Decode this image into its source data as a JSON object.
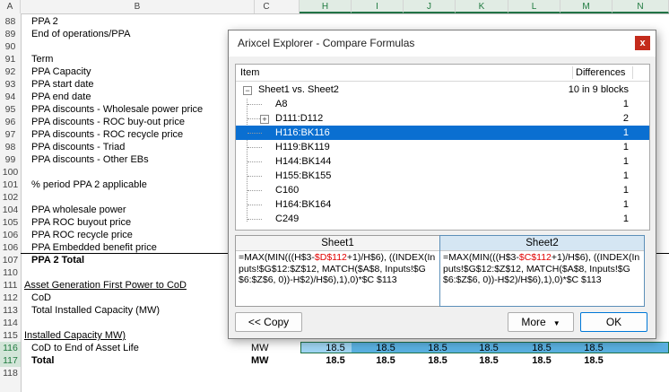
{
  "spreadsheet": {
    "columns": [
      "A",
      "B",
      "C",
      "H",
      "I",
      "J",
      "K",
      "L",
      "M",
      "N"
    ],
    "rows": [
      {
        "n": "88",
        "label": "PPA 2"
      },
      {
        "n": "89",
        "label": "End of operations/PPA"
      },
      {
        "n": "90",
        "label": ""
      },
      {
        "n": "91",
        "label": "Term"
      },
      {
        "n": "92",
        "label": "PPA Capacity"
      },
      {
        "n": "93",
        "label": "PPA start date"
      },
      {
        "n": "94",
        "label": "PPA end date"
      },
      {
        "n": "95",
        "label": "PPA discounts - Wholesale power price"
      },
      {
        "n": "96",
        "label": "PPA discounts - ROC buy-out price"
      },
      {
        "n": "97",
        "label": "PPA discounts - ROC recycle price"
      },
      {
        "n": "98",
        "label": "PPA discounts - Triad"
      },
      {
        "n": "99",
        "label": "PPA discounts - Other EBs"
      },
      {
        "n": "100",
        "label": ""
      },
      {
        "n": "101",
        "label": "% period PPA 2 applicable"
      },
      {
        "n": "102",
        "label": ""
      },
      {
        "n": "104",
        "label": "PPA wholesale power"
      },
      {
        "n": "105",
        "label": "PPA ROC buyout price"
      },
      {
        "n": "106",
        "label": "PPA ROC recycle price"
      },
      {
        "n": "106",
        "label": "PPA Embedded benefit price"
      },
      {
        "n": "107",
        "label": "PPA 2 Total"
      },
      {
        "n": "110",
        "label": ""
      },
      {
        "n": "111",
        "label": "Asset Generation First Power to CoD"
      },
      {
        "n": "112",
        "label": "CoD"
      },
      {
        "n": "113",
        "label": "Total Installed Capacity (MW)"
      },
      {
        "n": "114",
        "label": ""
      },
      {
        "n": "115",
        "label": "Installed Capacity MW)"
      },
      {
        "n": "116",
        "label": "CoD to End of Asset Life"
      },
      {
        "n": "117",
        "label": "Total"
      },
      {
        "n": "118",
        "label": ""
      }
    ],
    "unit_116": "MW",
    "unit_117": "MW",
    "values_116": [
      "18.5",
      "18.5",
      "18.5",
      "18.5",
      "18.5",
      "18.5"
    ],
    "values_117": [
      "18.5",
      "18.5",
      "18.5",
      "18.5",
      "18.5",
      "18.5"
    ]
  },
  "dialog": {
    "title": "Arixcel Explorer - Compare Formulas",
    "close": "x",
    "header_item": "Item",
    "header_diff": "Differences",
    "tree": [
      {
        "label": "Sheet1 vs. Sheet2",
        "diff": "10 in 9 blocks",
        "level": 0,
        "expander": "−",
        "selected": false
      },
      {
        "label": "A8",
        "diff": "1",
        "level": 1,
        "expander": "",
        "selected": false
      },
      {
        "label": "D111:D112",
        "diff": "2",
        "level": 1,
        "expander": "+",
        "selected": false
      },
      {
        "label": "H116:BK116",
        "diff": "1",
        "level": 1,
        "expander": "",
        "selected": true
      },
      {
        "label": "H119:BK119",
        "diff": "1",
        "level": 1,
        "expander": "",
        "selected": false
      },
      {
        "label": "H144:BK144",
        "diff": "1",
        "level": 1,
        "expander": "",
        "selected": false
      },
      {
        "label": "H155:BK155",
        "diff": "1",
        "level": 1,
        "expander": "",
        "selected": false
      },
      {
        "label": "C160",
        "diff": "1",
        "level": 1,
        "expander": "",
        "selected": false
      },
      {
        "label": "H164:BK164",
        "diff": "1",
        "level": 1,
        "expander": "",
        "selected": false
      },
      {
        "label": "C249",
        "diff": "1",
        "level": 1,
        "expander": "",
        "selected": false
      }
    ],
    "sheet1": {
      "title": "Sheet1",
      "formula_a": "=MAX(MIN(((H$3-",
      "formula_red": "$D$112",
      "formula_b": "+1)/H$6), ((INDEX(Inputs!$G$12:$Z$12, MATCH($A$8, Inputs!$G$6:$Z$6, 0))-H$2)/H$6),1),0)*$C $113"
    },
    "sheet2": {
      "title": "Sheet2",
      "formula_a": "=MAX(MIN(((H$3-",
      "formula_red": "$C$112",
      "formula_b": "+1)/H$6), ((INDEX(Inputs!$G$12:$Z$12, MATCH($A$8, Inputs!$G$6:$Z$6, 0))-H$2)/H$6),1),0)*$C $113"
    },
    "copy_button": "<< Copy",
    "more_button": "More",
    "ok_button": "OK"
  },
  "colors": {
    "selection_blue": "#0a6fd1",
    "excel_green": "#217346",
    "cell_blue": "#4aa3d8",
    "close_red": "#c42b1c"
  }
}
